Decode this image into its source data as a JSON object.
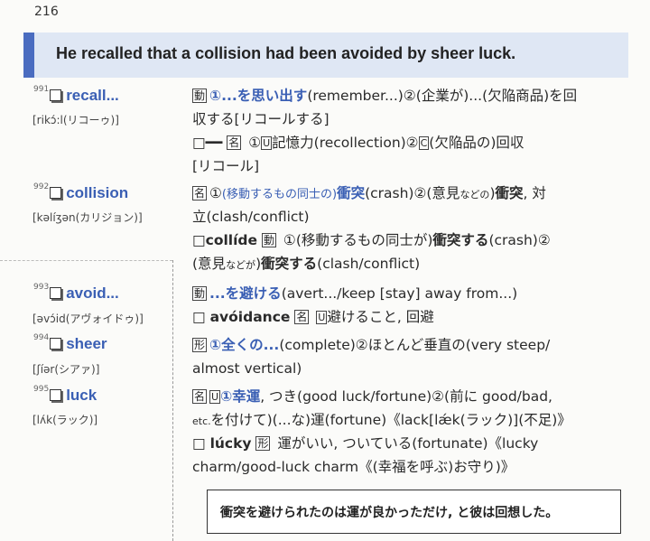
{
  "page_number": "216",
  "sentence": "He recalled that a collision had been avoided by sheer luck.",
  "entries": [
    {
      "num": "991",
      "word": "recall...",
      "pron": "[rikɔ́:l(リコーゥ)]",
      "lines": [
        {
          "pos": "動",
          "parts": [
            {
              "t": "①...を思い出す",
              "c": "blue"
            },
            {
              "t": "(remember...)②(企業が)...(欠陥商品)を回"
            }
          ]
        },
        {
          "parts": [
            {
              "t": "収する[リコールする]"
            }
          ]
        },
        {
          "parts": [
            {
              "t": "□━━ "
            },
            {
              "t": "名",
              "c": "box"
            },
            {
              "t": " ①"
            },
            {
              "t": "U",
              "c": "kbox"
            },
            {
              "t": "記憶力(recollection)②"
            },
            {
              "t": "C",
              "c": "kbox"
            },
            {
              "t": "(欠陥品の)回収"
            }
          ]
        },
        {
          "parts": [
            {
              "t": "[リコール]"
            }
          ]
        }
      ]
    },
    {
      "num": "992",
      "word": "collision",
      "pron": "[kəlíʒən(カリジョン)]",
      "lines": [
        {
          "pos": "名",
          "parts": [
            {
              "t": "①"
            },
            {
              "t": "(移動するもの同士の)",
              "c": "bluesmall"
            },
            {
              "t": "衝突",
              "c": "blue"
            },
            {
              "t": "(crash)②(意見"
            },
            {
              "t": "などの",
              "c": "tiny"
            },
            {
              "t": ")"
            },
            {
              "t": "衝突",
              "c": "bold"
            },
            {
              "t": ", 対"
            }
          ]
        },
        {
          "parts": [
            {
              "t": "立(clash/conflict)"
            }
          ]
        },
        {
          "parts": [
            {
              "t": "□"
            },
            {
              "t": "collíde",
              "c": "bold"
            },
            {
              "t": " "
            },
            {
              "t": "動",
              "c": "box"
            },
            {
              "t": " ①(移動するもの同士が)"
            },
            {
              "t": "衝突する",
              "c": "bold"
            },
            {
              "t": "(crash)②"
            }
          ]
        },
        {
          "parts": [
            {
              "t": "(意見"
            },
            {
              "t": "などが",
              "c": "tiny"
            },
            {
              "t": ")"
            },
            {
              "t": "衝突する",
              "c": "bold"
            },
            {
              "t": "(clash/conflict)"
            }
          ]
        }
      ]
    },
    {
      "num": "993",
      "word": "avoid...",
      "pron": "[əvɔ́id(アヴォイドゥ)]",
      "lines": [
        {
          "pos": "動",
          "parts": [
            {
              "t": "...を避ける",
              "c": "blue"
            },
            {
              "t": "(avert.../keep [stay] away from...)"
            }
          ]
        },
        {
          "parts": [
            {
              "t": "□ "
            },
            {
              "t": "avóidance",
              "c": "bold"
            },
            {
              "t": " "
            },
            {
              "t": "名",
              "c": "box"
            },
            {
              "t": " "
            },
            {
              "t": "U",
              "c": "kbox"
            },
            {
              "t": "避けること, 回避"
            }
          ]
        }
      ]
    },
    {
      "num": "994",
      "word": "sheer",
      "pron": "[ʃíər(シアァ)]",
      "lines": [
        {
          "pos": "形",
          "parts": [
            {
              "t": "①全くの...",
              "c": "blue"
            },
            {
              "t": "(complete)②ほとんど垂直の(very steep/"
            }
          ]
        },
        {
          "parts": [
            {
              "t": "almost vertical)"
            }
          ]
        }
      ]
    },
    {
      "num": "995",
      "word": "luck",
      "pron": "[lʌ́k(ラック)]",
      "lines": [
        {
          "pos": "名",
          "parts": [
            {
              "t": "U",
              "c": "kbox"
            },
            {
              "t": "①幸運",
              "c": "blue"
            },
            {
              "t": ", つき(good luck/fortune)②(前に good/bad,"
            }
          ]
        },
        {
          "parts": [
            {
              "t": "etc.",
              "c": "tiny"
            },
            {
              "t": "を付けて)(...な)運(fortune)《lack[lǽk(ラック)](不足)》"
            }
          ]
        },
        {
          "parts": [
            {
              "t": "□ "
            },
            {
              "t": "lúcky",
              "c": "bold"
            },
            {
              "t": " "
            },
            {
              "t": "形",
              "c": "box"
            },
            {
              "t": " 運がいい, ついている(fortunate)《lucky"
            }
          ]
        },
        {
          "parts": [
            {
              "t": "charm/good-luck charm《(幸福を呼ぶ)お守り)》"
            }
          ]
        }
      ]
    }
  ],
  "translation": "衝突を避けられたのは運が良かっただけ, と彼は回想した。"
}
